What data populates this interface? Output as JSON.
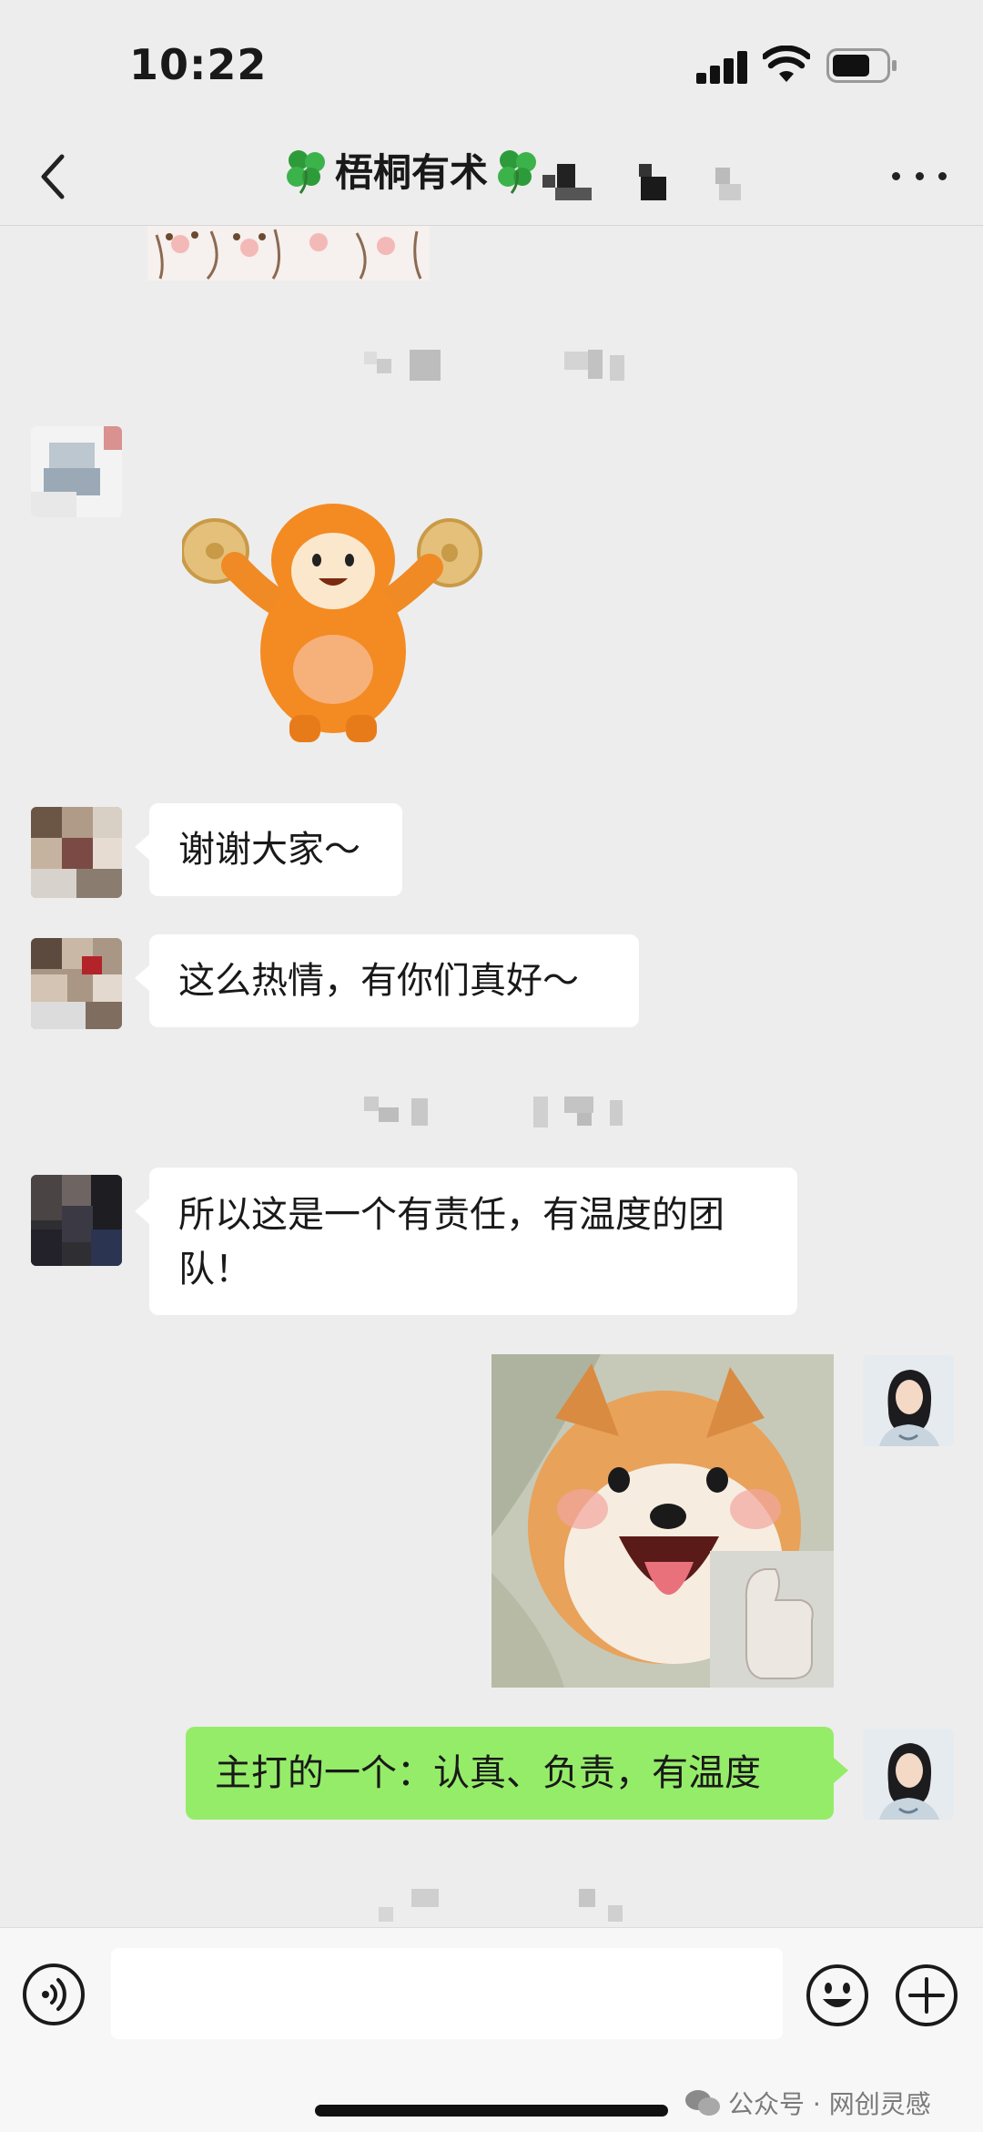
{
  "status_bar": {
    "time": "10:22"
  },
  "nav": {
    "title": "梧桐有术",
    "back_icon": "chevron-left-icon",
    "more_icon": "more-dots-icon"
  },
  "messages": [
    {
      "type": "text",
      "side": "left",
      "text": "谢谢大家～"
    },
    {
      "type": "text",
      "side": "left",
      "text": "这么热情，有你们真好～"
    },
    {
      "type": "text",
      "side": "left",
      "text": "所以这是一个有责任，有温度的团队！"
    },
    {
      "type": "image",
      "side": "right",
      "sticker": "shiba-dog-thumbs-up"
    },
    {
      "type": "text",
      "side": "right",
      "text": "主打的一个：认真、负责，有温度"
    }
  ],
  "input_bar": {
    "voice_icon": "voice-icon",
    "emoji_icon": "emoji-icon",
    "plus_icon": "plus-icon",
    "input_value": ""
  },
  "watermark": {
    "text": "公众号 · 网创灵感"
  },
  "colors": {
    "background": "#ededed",
    "bubble_in": "#ffffff",
    "bubble_out": "#95ec69",
    "input_bar": "#f7f7f7"
  }
}
